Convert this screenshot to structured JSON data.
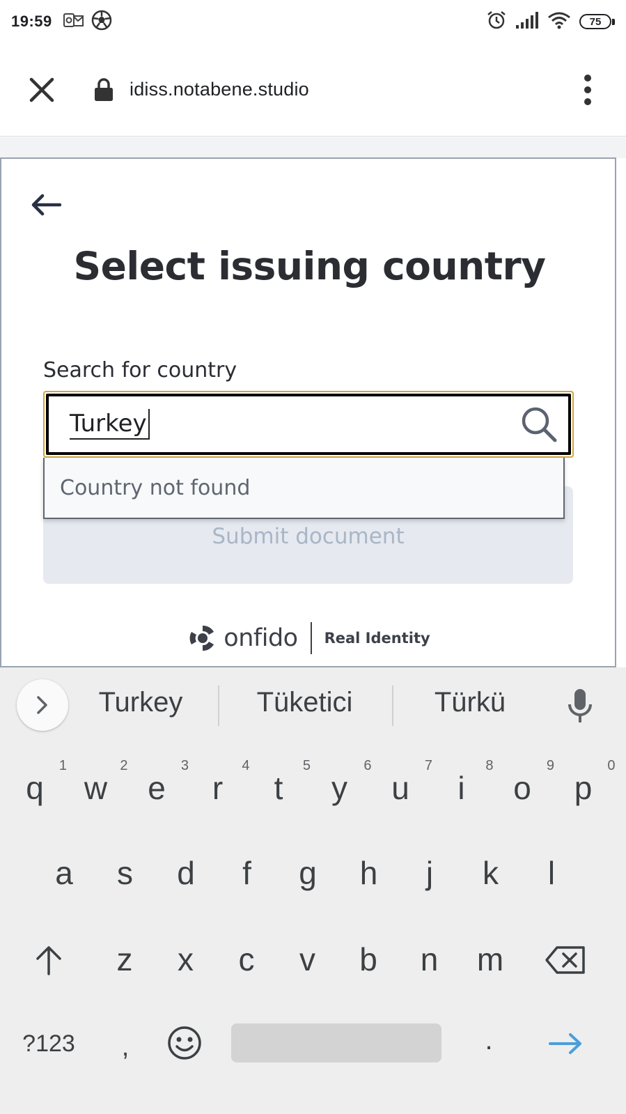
{
  "status_bar": {
    "time": "19:59",
    "left_icons": [
      "outlook-icon",
      "soccer-ball-icon"
    ],
    "right_icons": [
      "alarm-icon",
      "signal-icon",
      "wifi-icon"
    ],
    "battery_level": "75"
  },
  "browser": {
    "url": "idiss.notabene.studio"
  },
  "page": {
    "title": "Select issuing country",
    "search_label": "Search for country",
    "search_value": "Turkey",
    "dropdown_message": "Country not found",
    "submit_label": "Submit document",
    "footer_brand": "onfido",
    "footer_tagline": "Real Identity"
  },
  "keyboard": {
    "suggestions": [
      "Turkey",
      "Tüketici",
      "Türkü"
    ],
    "row1": [
      {
        "k": "q",
        "h": "1"
      },
      {
        "k": "w",
        "h": "2"
      },
      {
        "k": "e",
        "h": "3"
      },
      {
        "k": "r",
        "h": "4"
      },
      {
        "k": "t",
        "h": "5"
      },
      {
        "k": "y",
        "h": "6"
      },
      {
        "k": "u",
        "h": "7"
      },
      {
        "k": "i",
        "h": "8"
      },
      {
        "k": "o",
        "h": "9"
      },
      {
        "k": "p",
        "h": "0"
      }
    ],
    "row2": [
      "a",
      "s",
      "d",
      "f",
      "g",
      "h",
      "j",
      "k",
      "l"
    ],
    "row3": [
      "z",
      "x",
      "c",
      "v",
      "b",
      "n",
      "m"
    ],
    "symbols_label": "?123",
    "comma": ",",
    "period": ".",
    "accent_color": "#4a9fd8"
  }
}
